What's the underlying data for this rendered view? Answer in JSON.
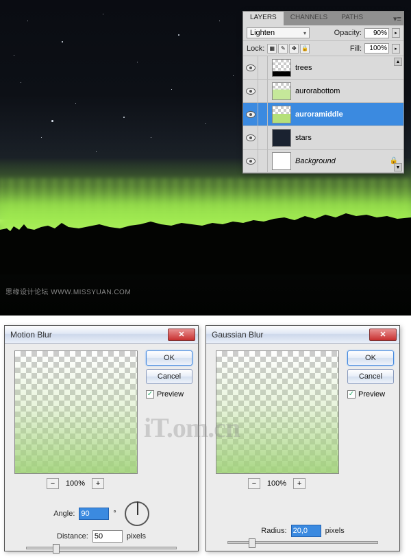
{
  "canvas": {
    "watermark": "思缘设计论坛  WWW.MISSYUAN.COM"
  },
  "layers_panel": {
    "tabs": [
      "LAYERS",
      "CHANNELS",
      "PATHS"
    ],
    "blend_mode": "Lighten",
    "opacity_label": "Opacity:",
    "opacity": "90%",
    "lock_label": "Lock:",
    "fill_label": "Fill:",
    "fill": "100%",
    "layers": [
      {
        "name": "trees",
        "thumb": "trees-th",
        "sel": false,
        "italic": false
      },
      {
        "name": "aurorabottom",
        "thumb": "ab-th",
        "sel": false,
        "italic": false
      },
      {
        "name": "auroramiddle",
        "thumb": "am-th",
        "sel": true,
        "italic": false
      },
      {
        "name": "stars",
        "thumb": "stars-th",
        "sel": false,
        "italic": false
      },
      {
        "name": "Background",
        "thumb": "bg-th",
        "sel": false,
        "italic": true,
        "locked": true
      }
    ]
  },
  "dialog_motion": {
    "title": "Motion Blur",
    "ok": "OK",
    "cancel": "Cancel",
    "preview": "Preview",
    "zoom": "100%",
    "angle_label": "Angle:",
    "angle": "90",
    "deg": "°",
    "distance_label": "Distance:",
    "distance": "50",
    "unit": "pixels"
  },
  "dialog_gauss": {
    "title": "Gaussian Blur",
    "ok": "OK",
    "cancel": "Cancel",
    "preview": "Preview",
    "zoom": "100%",
    "radius_label": "Radius:",
    "radius": "20,0",
    "unit": "pixels"
  },
  "big_watermark": "iT.om.cn",
  "chart_data": null
}
